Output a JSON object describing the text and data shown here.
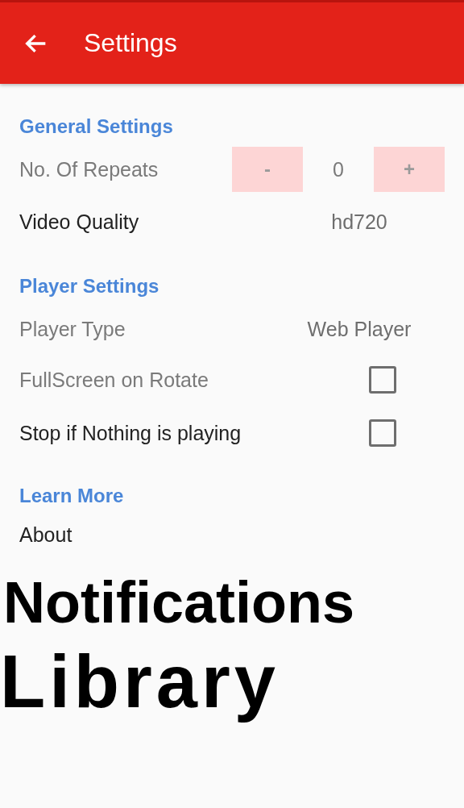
{
  "app_bar": {
    "title": "Settings"
  },
  "sections": [
    {
      "title": "General Settings",
      "items": [
        {
          "kind": "stepper",
          "label": "No. Of Repeats",
          "disabled": true,
          "decrement": "-",
          "value": "0",
          "increment": "+"
        },
        {
          "kind": "value",
          "label": "Video Quality",
          "disabled": false,
          "value": "hd720"
        }
      ]
    },
    {
      "title": "Player Settings",
      "items": [
        {
          "kind": "value",
          "label": "Player Type",
          "disabled": true,
          "value": "Web Player"
        },
        {
          "kind": "checkbox",
          "label": "FullScreen on Rotate",
          "disabled": true,
          "checked": false
        },
        {
          "kind": "checkbox",
          "label": "Stop if Nothing is playing",
          "disabled": false,
          "checked": false
        }
      ]
    },
    {
      "title": "Learn More",
      "items": [
        {
          "kind": "link",
          "label": "About",
          "disabled": false
        }
      ]
    }
  ],
  "overlay_captions": [
    "Notifications",
    "Library"
  ]
}
